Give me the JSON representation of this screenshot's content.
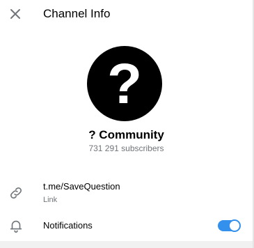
{
  "header": {
    "close_icon": "close-icon",
    "title": "Channel Info"
  },
  "channel": {
    "avatar_glyph": "?",
    "name": "? Community",
    "subscribers": "731 291 subscribers"
  },
  "link_row": {
    "icon": "link-icon",
    "value": "t.me/SaveQuestion",
    "label": "Link"
  },
  "notifications_row": {
    "icon": "bell-icon",
    "label": "Notifications",
    "enabled": true
  },
  "colors": {
    "accent": "#3390ec",
    "secondary_text": "#707579",
    "avatar_bg": "#000000"
  }
}
